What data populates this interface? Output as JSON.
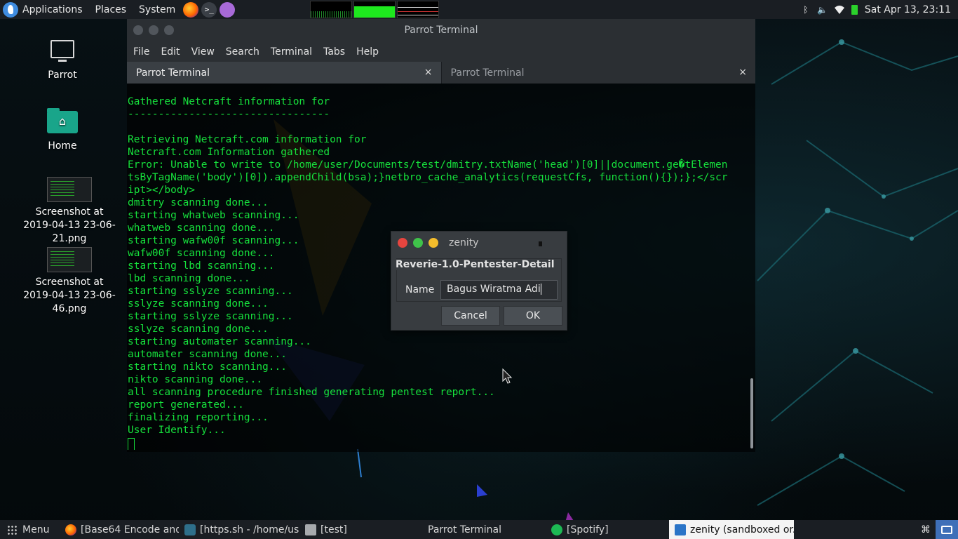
{
  "top_panel": {
    "menus": [
      "Applications",
      "Places",
      "System"
    ],
    "launchers": [
      {
        "icon": "firefox-icon"
      },
      {
        "icon": "terminal-icon",
        "glyph": ">_"
      },
      {
        "icon": "text-editor-icon"
      }
    ],
    "clock": "Sat Apr 13, 23:11"
  },
  "desktop": {
    "icons": [
      {
        "label": "Parrot",
        "icon": "computer-icon"
      },
      {
        "label": "Home",
        "icon": "home-folder-icon"
      },
      {
        "label": "Screenshot at 2019-04-13 23-06-21.png",
        "icon": "image-thumbnail-icon"
      },
      {
        "label": "Screenshot at 2019-04-13 23-06-46.png",
        "icon": "image-thumbnail-icon"
      }
    ]
  },
  "terminal": {
    "title": "Parrot Terminal",
    "menu": [
      "File",
      "Edit",
      "View",
      "Search",
      "Terminal",
      "Tabs",
      "Help"
    ],
    "tabs": [
      {
        "label": "Parrot Terminal",
        "active": true
      },
      {
        "label": "Parrot Terminal",
        "active": false
      }
    ],
    "close_glyph": "×",
    "lines": [
      "Gathered Netcraft information for ",
      "---------------------------------",
      "",
      "Retrieving Netcraft.com information for ",
      "Netcraft.com Information gathered",
      "Error: Unable to write to /home/user/Documents/test/dmitry.txtName('head')[0]||document.ge�tElemen",
      "tsByTagName('body')[0]).appendChild(bsa);}netbro_cache_analytics(requestCfs, function(){});};</scr",
      "ipt></body>",
      "dmitry scanning done...",
      "starting whatweb scanning...",
      "whatweb scanning done...",
      "starting wafw00f scanning...",
      "wafw00f scanning done...",
      "starting lbd scanning...",
      "lbd scanning done...",
      "starting sslyze scanning...",
      "sslyze scanning done...",
      "starting sslyze scanning...",
      "sslyze scanning done...",
      "starting automater scanning...",
      "automater scanning done...",
      "starting nikto scanning...",
      "nikto scanning done...",
      "all scanning procedure finished generating pentest report...",
      "report generated...",
      "finalizing reporting...",
      "User Identify..."
    ],
    "text_color": "#16e03c"
  },
  "dialog": {
    "title": "zenity",
    "heading": "Reverie-1.0-Pentester-Detail",
    "field_label": "Name",
    "field_value": "Bagus Wiratma Adi",
    "cancel_label": "Cancel",
    "ok_label": "OK"
  },
  "taskbar": {
    "menu_label": "Menu",
    "tasks": [
      {
        "label": "[Base64 Encode and...",
        "icon": "firefox-icon",
        "cls": "firefox",
        "width": 170
      },
      {
        "label": "[https.sh - /home/us...",
        "icon": "script-icon",
        "cls": "https",
        "width": 172
      },
      {
        "label": "[test]",
        "icon": "folder-icon",
        "cls": "folder",
        "width": 175
      },
      {
        "label": "Parrot Terminal",
        "icon": "terminal-icon",
        "cls": "terminal",
        "width": 176
      },
      {
        "label": "[Spotify]",
        "icon": "spotify-icon",
        "cls": "spotify",
        "width": 176
      },
      {
        "label": "zenity (sandboxed or...",
        "icon": "zenity-icon",
        "cls": "zenity-ic",
        "width": 178,
        "active": true
      }
    ]
  },
  "colors": {
    "panel": "#1a1e23",
    "terminal_text": "#16e03c",
    "accent_blue": "#3e6fb8"
  }
}
